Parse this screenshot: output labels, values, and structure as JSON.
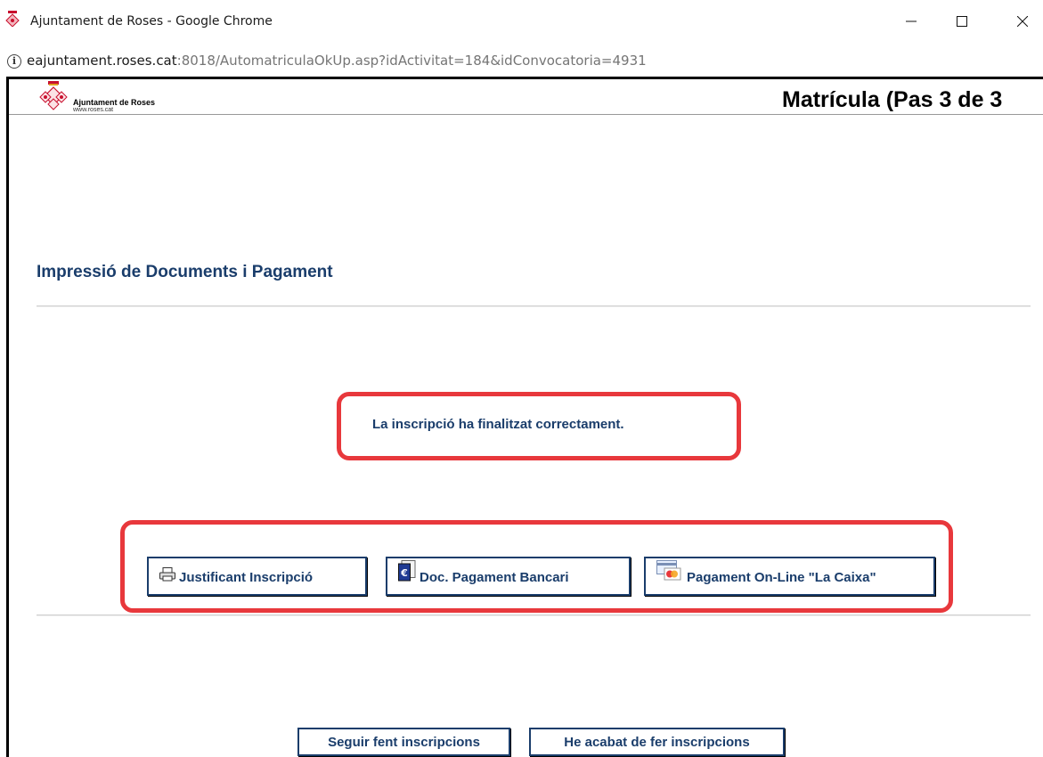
{
  "window": {
    "title": "Ajuntament de Roses - Google Chrome",
    "controls": {
      "minimize": "minimize-icon",
      "maximize": "maximize-icon",
      "close": "close-icon"
    }
  },
  "address_bar": {
    "host": "eajuntament.roses.cat",
    "rest": ":8018/AutomatriculaOkUp.asp?idActivitat=184&idConvocatoria=4931"
  },
  "header": {
    "logo_name": "Ajuntament de Roses",
    "logo_url": "www.roses.cat",
    "heading": "Matrícula (Pas 3 de 3"
  },
  "main": {
    "section_title": "Impressió de Documents i Pagament",
    "success_message": "La inscripció ha finalitzat correctament.",
    "document_buttons": [
      {
        "label": "Justificant Inscripció",
        "icon": "printer-icon"
      },
      {
        "label": "Doc. Pagament Bancari",
        "icon": "euro-document-icon"
      },
      {
        "label": "Pagament On-Line \"La Caixa\"",
        "icon": "credit-card-icon"
      }
    ],
    "nav_buttons": [
      {
        "label": "Seguir fent inscripcions"
      },
      {
        "label": "He acabat de fer inscripcions"
      }
    ]
  },
  "colors": {
    "accent": "#1a3d6b",
    "highlight": "#e8383c",
    "logo_red": "#c8102e"
  }
}
